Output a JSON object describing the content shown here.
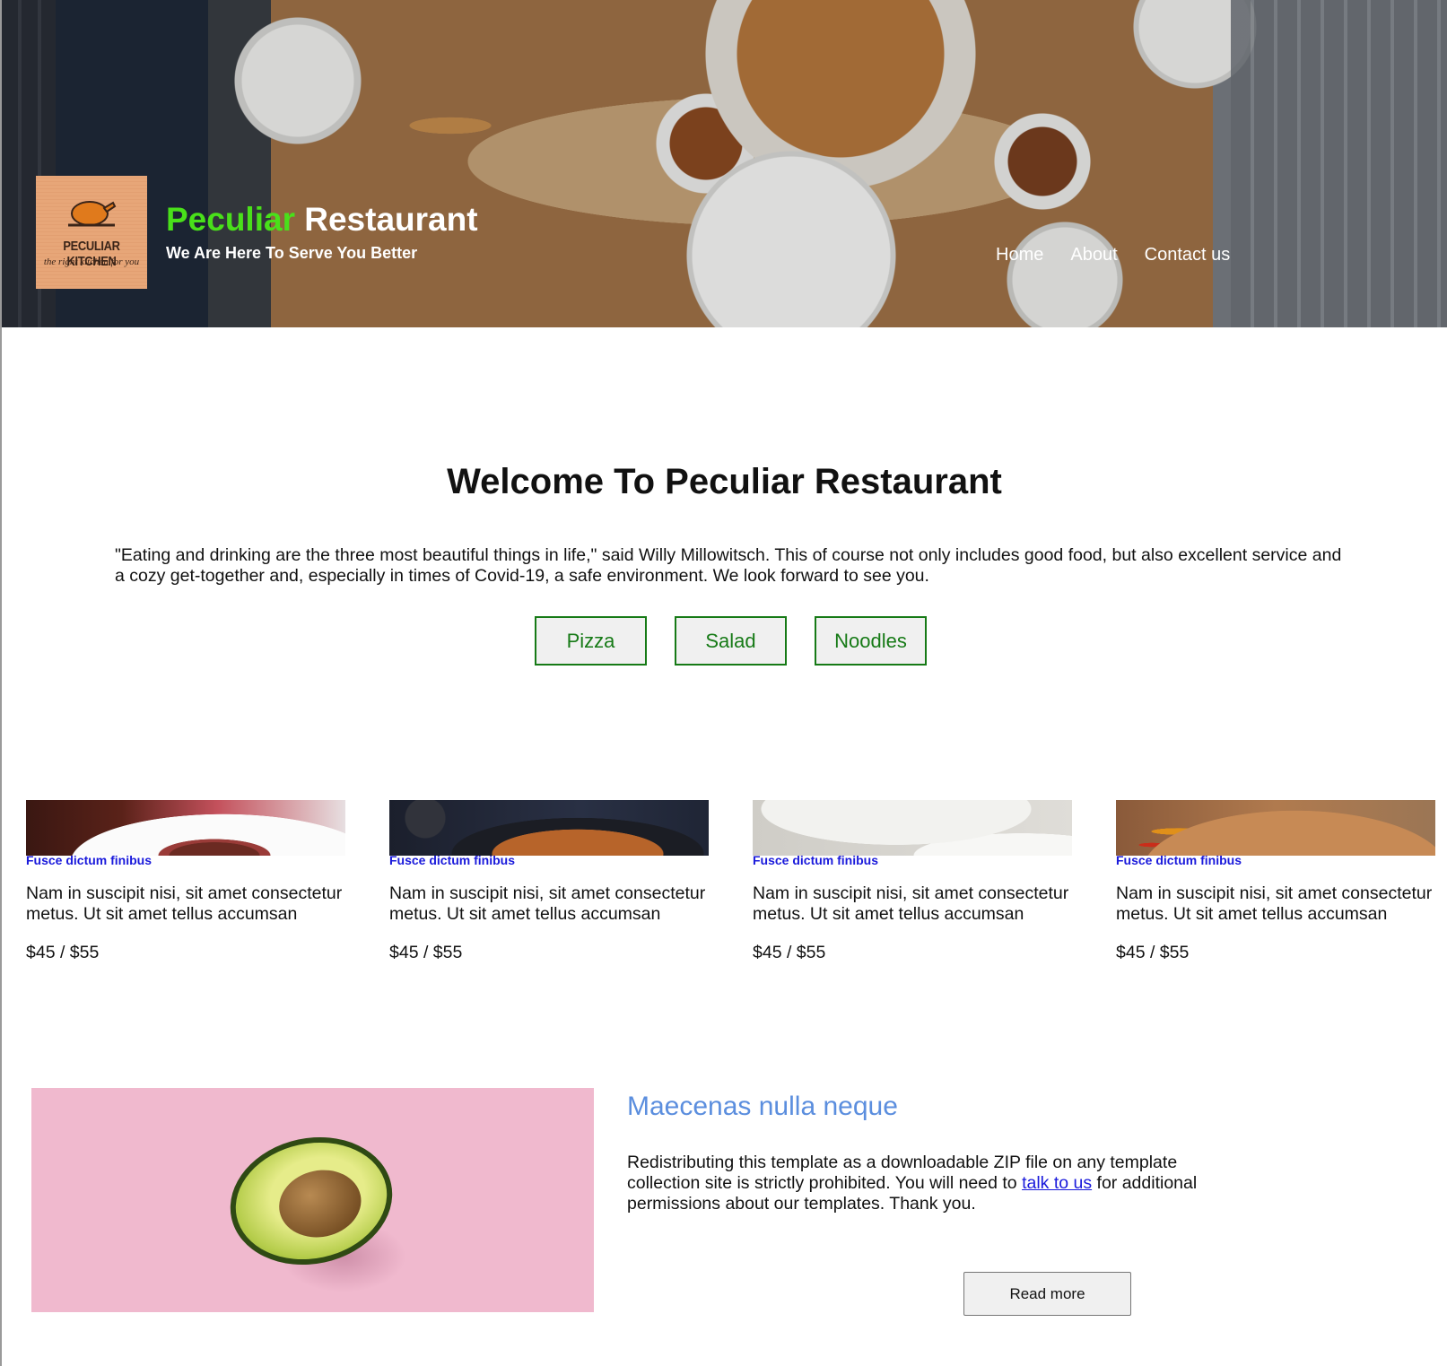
{
  "header": {
    "logo": {
      "brand": "PECULIAR KITCHEN",
      "tagline": "the right kitchen for you",
      "icon": "roast-chicken-icon"
    },
    "title_part1": "Peculiar",
    "title_part2": " Restaurant",
    "tagline": "We Are Here To Serve You Better",
    "nav": [
      "Home",
      "About",
      "Contact us"
    ],
    "colors": {
      "title_accent": "#49e01a",
      "title_main": "#ffffff"
    }
  },
  "welcome": {
    "title": "Welcome To Peculiar Restaurant",
    "text": "\"Eating and drinking are the three most beautiful things in life,\" said Willy Millowitsch. This of course not only includes good food, but also excellent service and a cozy get-together and, especially in times of Covid-19, a safe environment. We look forward to see you.",
    "categories": [
      "Pizza",
      "Salad",
      "Noodles"
    ],
    "category_color": "#167a16"
  },
  "cards": [
    {
      "image": "steak-photo",
      "kicker": "Fusce dictum finibus",
      "description": "Nam in suscipit nisi, sit amet consectetur metus. Ut sit amet tellus accumsan",
      "price": "$45 / $55"
    },
    {
      "image": "noodle-pan-photo",
      "kicker": "Fusce dictum finibus",
      "description": "Nam in suscipit nisi, sit amet consectetur metus. Ut sit amet tellus accumsan",
      "price": "$45 / $55"
    },
    {
      "image": "salad-photo",
      "kicker": "Fusce dictum finibus",
      "description": "Nam in suscipit nisi, sit amet consectetur metus. Ut sit amet tellus accumsan",
      "price": "$45 / $55"
    },
    {
      "image": "vegetables-photo",
      "kicker": "Fusce dictum finibus",
      "description": "Nam in suscipit nisi, sit amet consectetur metus. Ut sit amet tellus accumsan",
      "price": "$45 / $55"
    }
  ],
  "feature": {
    "image": "avocado-photo",
    "title": "Maecenas nulla neque",
    "text_before": "Redistributing this template as a downloadable ZIP file on any template collection site is strictly prohibited. You will need to ",
    "link_text": "talk to us",
    "text_after": " for additional permissions about our templates. Thank you.",
    "button": "Read more",
    "title_color": "#5b8ede"
  }
}
